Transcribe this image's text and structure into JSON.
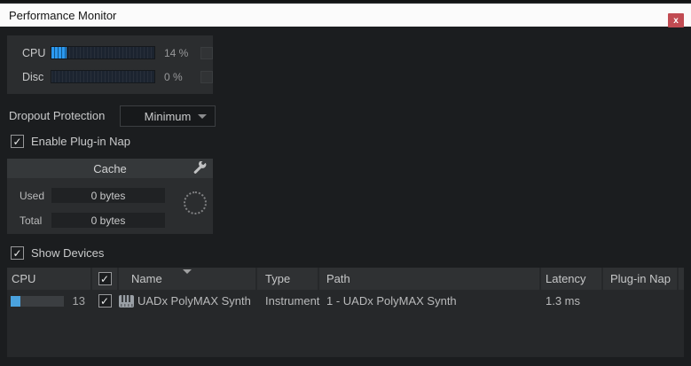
{
  "window": {
    "title": "Performance Monitor",
    "close_label": "x"
  },
  "icons": {
    "check": "✓",
    "wrench": "wrench-icon",
    "sort_desc": "triangle-down",
    "dropdown_arrow": "triangle-down",
    "spinner": "dotted-circle",
    "instrument": "keyboard-icon"
  },
  "colors": {
    "accent_blue": "#2c99f0",
    "row_meter_blue": "#4aa2de",
    "close_red": "#c14b52",
    "panel_bg": "#2b2d2f",
    "window_bg": "#1b1d1f"
  },
  "meters": {
    "cpu": {
      "label": "CPU",
      "value_pct": 14,
      "value_text": "14 %"
    },
    "disc": {
      "label": "Disc",
      "value_pct": 0,
      "value_text": "0 %"
    }
  },
  "dropout": {
    "label": "Dropout Protection",
    "value": "Minimum"
  },
  "plugin_nap": {
    "label": "Enable Plug-in Nap",
    "checked": true
  },
  "cache": {
    "title": "Cache",
    "used": {
      "label": "Used",
      "value": "0 bytes"
    },
    "total": {
      "label": "Total",
      "value": "0 bytes"
    }
  },
  "show_devices": {
    "label": "Show Devices",
    "checked": true
  },
  "devices_table": {
    "columns": {
      "cpu": "CPU",
      "name": "Name",
      "type": "Type",
      "path": "Path",
      "latency": "Latency",
      "plugin_nap": "Plug-in Nap"
    },
    "sorted_column": "Name",
    "rows": [
      {
        "cpu": "13",
        "cpu_pct": 18,
        "checked": true,
        "name": "UADx PolyMAX Synth",
        "type": "Instrument",
        "path": "1 - UADx PolyMAX Synth",
        "latency": "1.3 ms",
        "plugin_nap": ""
      }
    ]
  }
}
